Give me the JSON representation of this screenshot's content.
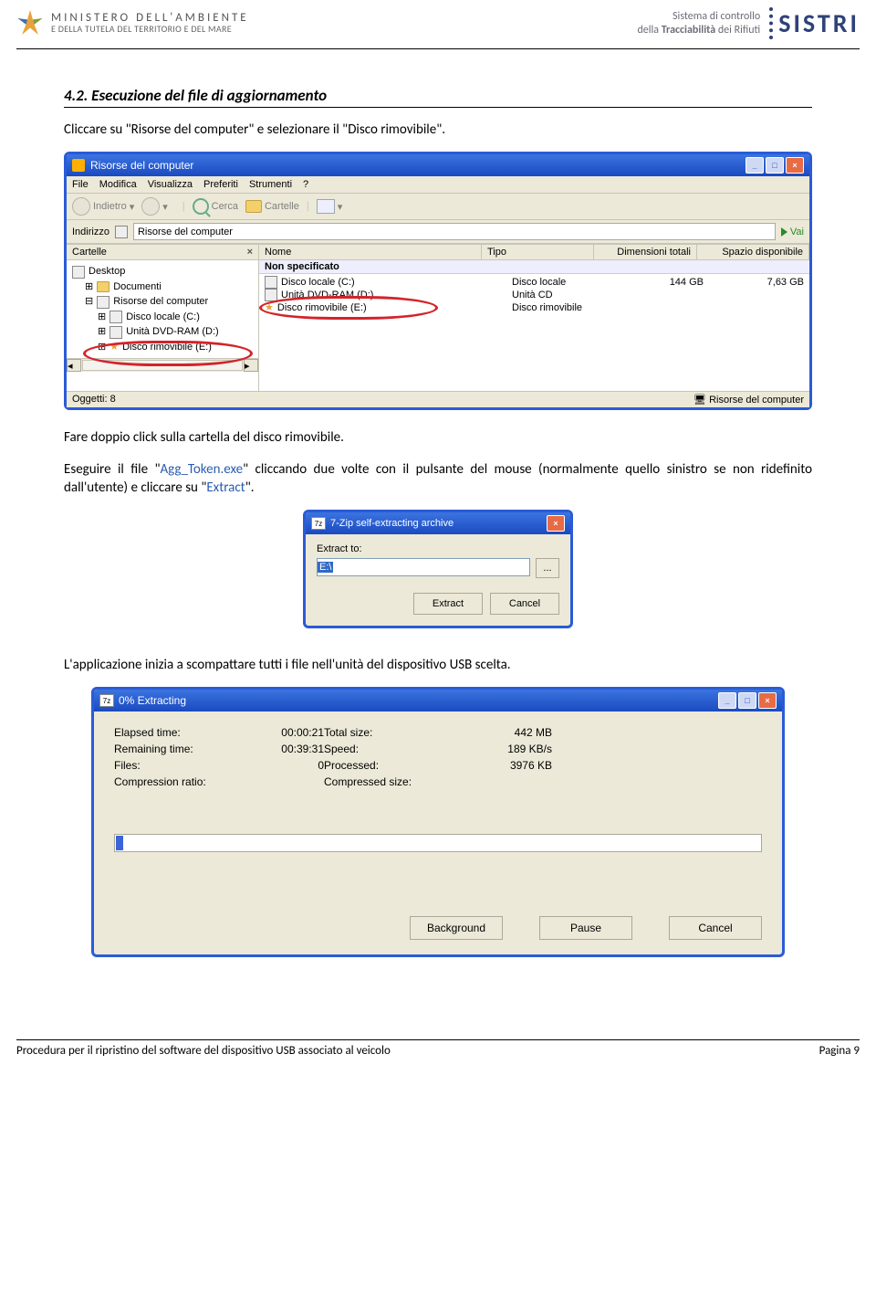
{
  "header": {
    "ministry_line1": "MINISTERO DELL'AMBIENTE",
    "ministry_line2": "E DELLA TUTELA DEL TERRITORIO E DEL MARE",
    "sistri_line1": "Sistema di controllo",
    "sistri_line2": "della Tracciabilità dei Rifiuti",
    "sistri_logo": "SISTRI"
  },
  "section": {
    "number": "4.2.",
    "title": "Esecuzione del file di aggiornamento"
  },
  "para1": "Cliccare su \"Risorse del computer\" e selezionare il \"Disco rimovibile\".",
  "para2": "Fare doppio click sulla cartella del disco rimovibile.",
  "para3_a": "Eseguire il file \"",
  "para3_link1": "Agg_Token.exe",
  "para3_b": "\" cliccando due volte con il pulsante del mouse (normalmente quello sinistro se non ridefinito dall'utente) e cliccare su \"",
  "para3_link2": "Extract",
  "para3_c": "\".",
  "para4": "L'applicazione inizia a scompattare tutti i file nell'unità del dispositivo USB scelta.",
  "explorer": {
    "title": "Risorse del computer",
    "menu": [
      "File",
      "Modifica",
      "Visualizza",
      "Preferiti",
      "Strumenti",
      "?"
    ],
    "back": "Indietro",
    "search": "Cerca",
    "folders_btn": "Cartelle",
    "address_label": "Indirizzo",
    "address_value": "Risorse del computer",
    "go": "Vai",
    "folders_hdr": "Cartelle",
    "tree": {
      "desktop": "Desktop",
      "documenti": "Documenti",
      "risorse": "Risorse del computer",
      "disco_c": "Disco locale (C:)",
      "dvd": "Unità DVD-RAM (D:)",
      "rimovibile": "Disco rimovibile (E:)"
    },
    "cols": {
      "name": "Nome",
      "type": "Tipo",
      "dim": "Dimensioni totali",
      "free": "Spazio disponibile"
    },
    "group": "Non specificato",
    "rows": [
      {
        "name": "Disco locale (C:)",
        "type": "Disco locale",
        "dim": "144 GB",
        "free": "7,63 GB"
      },
      {
        "name": "Unità DVD-RAM (D:)",
        "type": "Unità CD",
        "dim": "",
        "free": ""
      },
      {
        "name": "Disco rimovibile (E:)",
        "type": "Disco rimovibile",
        "dim": "",
        "free": ""
      }
    ],
    "status_left": "Oggetti: 8",
    "status_right": "Risorse del computer"
  },
  "sfx": {
    "title": "7-Zip self-extracting archive",
    "label": "Extract to:",
    "value": "E:\\",
    "browse": "...",
    "extract": "Extract",
    "cancel": "Cancel"
  },
  "extract": {
    "title": "0% Extracting",
    "elapsed_l": "Elapsed time:",
    "elapsed_v": "00:00:21",
    "remaining_l": "Remaining time:",
    "remaining_v": "00:39:31",
    "files_l": "Files:",
    "files_v": "0",
    "comp_l": "Compression ratio:",
    "comp_v": "",
    "total_l": "Total size:",
    "total_v": "442 MB",
    "speed_l": "Speed:",
    "speed_v": "189 KB/s",
    "proc_l": "Processed:",
    "proc_v": "3976 KB",
    "csize_l": "Compressed size:",
    "csize_v": "",
    "background": "Background",
    "pause": "Pause",
    "cancel": "Cancel"
  },
  "footer": {
    "left": "Procedura per il ripristino del software del dispositivo USB associato al veicolo",
    "right": "Pagina 9"
  }
}
